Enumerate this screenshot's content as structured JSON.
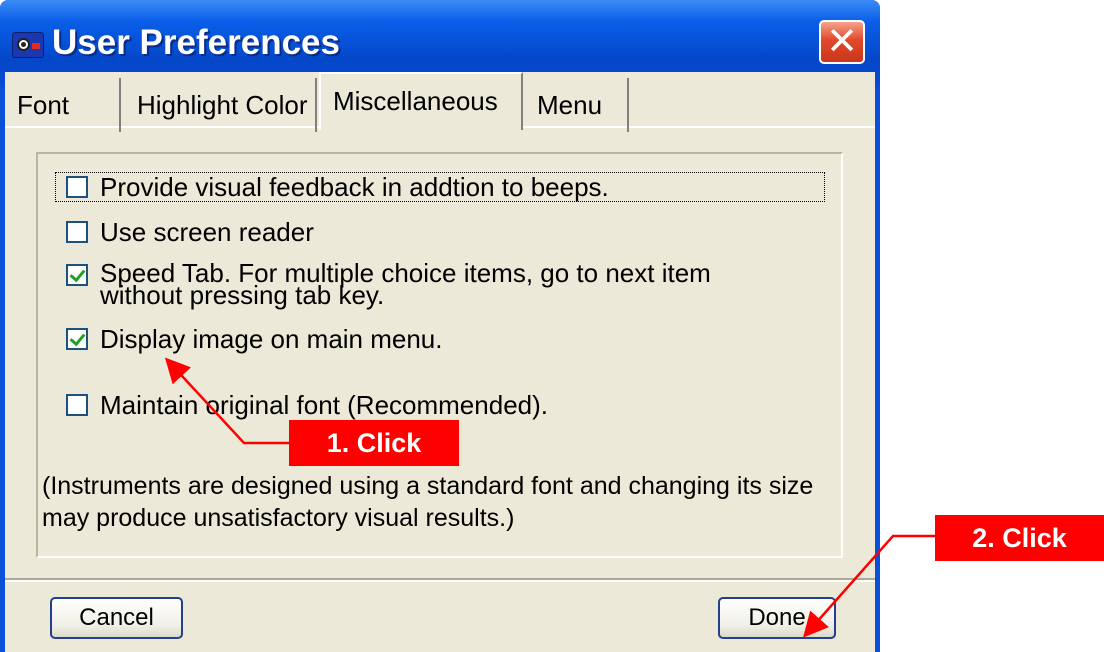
{
  "window": {
    "title": "User Preferences",
    "close_glyph": "✕",
    "app_icon": "app-logo-icon"
  },
  "tabs": [
    {
      "label": "Font",
      "active": false
    },
    {
      "label": "Highlight Color",
      "active": false
    },
    {
      "label": "Miscellaneous",
      "active": true
    },
    {
      "label": "Menu",
      "active": false
    }
  ],
  "options": [
    {
      "label": "Provide visual feedback in addtion to beeps.",
      "checked": false
    },
    {
      "label": "Use screen reader",
      "checked": false
    },
    {
      "label": "Speed Tab. For multiple choice items, go to next item",
      "label_line2": "without pressing tab key.",
      "checked": true
    },
    {
      "label": "Display image on main menu.",
      "checked": true
    },
    {
      "label": "Maintain original font (Recommended).",
      "checked": false
    }
  ],
  "note": "(Instruments are designed using a standard font and changing its size may produce unsatisfactory visual results.)",
  "buttons": {
    "cancel": "Cancel",
    "done": "Done"
  },
  "annotations": {
    "step1": "1. Click",
    "step2": "2. Click",
    "color": "#ff0000"
  }
}
